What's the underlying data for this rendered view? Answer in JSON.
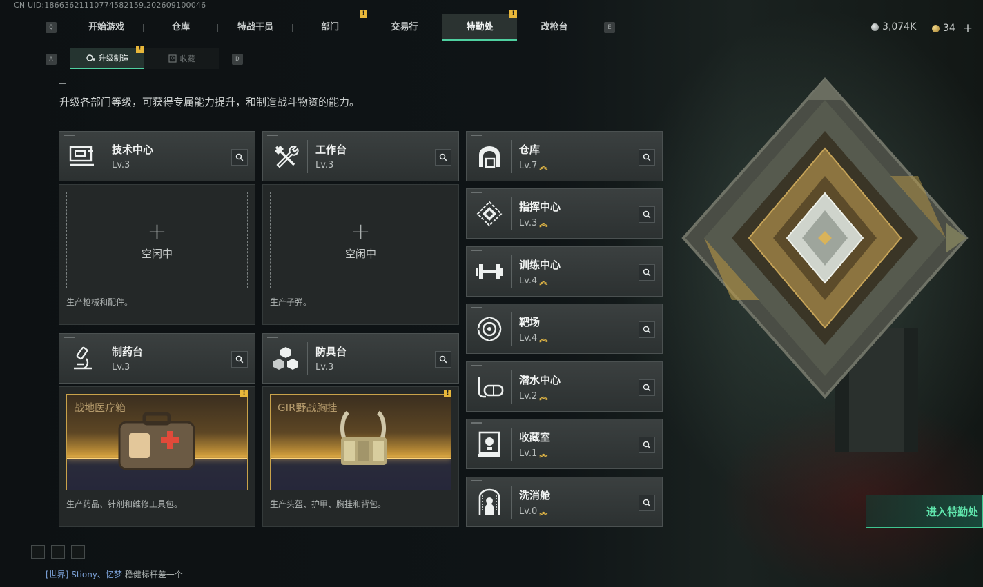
{
  "uid_line": "CN UID:18663621110774582159.202609100046",
  "nav": {
    "left_key": "Q",
    "right_key": "E",
    "tabs": [
      "开始游戏",
      "仓库",
      "特战干员",
      "部门",
      "交易行",
      "特勤处",
      "改枪台"
    ],
    "active_index": 5,
    "badge_mark": "!"
  },
  "currency": {
    "coins": "3,074K",
    "gold": "34",
    "plus": "+"
  },
  "subnav": {
    "left_key": "A",
    "right_key": "D",
    "upgrade_label": "升级制造",
    "collection_label": "收藏"
  },
  "description": "升级各部门等级，可获得专属能力提升，和制造战斗物资的能力。",
  "production_cards": [
    {
      "name": "技术中心",
      "level": "Lv.3",
      "icon": "computer-icon",
      "state": "空闲中",
      "caption": "生产枪械和配件。"
    },
    {
      "name": "工作台",
      "level": "Lv.3",
      "icon": "tools-icon",
      "state": "空闲中",
      "caption": "生产子弹。"
    },
    {
      "name": "制药台",
      "level": "Lv.3",
      "icon": "microscope-icon",
      "item": "战地医疗箱",
      "caption": "生产药品、针剂和维修工具包。"
    },
    {
      "name": "防具台",
      "level": "Lv.3",
      "icon": "armor-blocks-icon",
      "item": "GIR野战胸挂",
      "caption": "生产头盔、护甲、胸挂和背包。"
    }
  ],
  "plus_sign": "+",
  "facilities": [
    {
      "name": "仓库",
      "level": "Lv.7",
      "icon": "warehouse-icon"
    },
    {
      "name": "指挥中心",
      "level": "Lv.3",
      "icon": "command-icon"
    },
    {
      "name": "训练中心",
      "level": "Lv.4",
      "icon": "dumbbell-icon"
    },
    {
      "name": "靶场",
      "level": "Lv.4",
      "icon": "target-icon"
    },
    {
      "name": "潜水中心",
      "level": "Lv.2",
      "icon": "diving-mask-icon"
    },
    {
      "name": "收藏室",
      "level": "Lv.1",
      "icon": "trophy-case-icon"
    },
    {
      "name": "洗消舱",
      "level": "Lv.0",
      "icon": "decontamination-icon"
    }
  ],
  "upgrade_arrow": "︽",
  "enter_button": "进入特勤处",
  "chat": {
    "channel": "[世界]",
    "user": "Stiony、忆梦",
    "message": "稳健标杆差一个"
  },
  "colors": {
    "accent": "#4fd0a0",
    "badge": "#e8b73a",
    "gold_frame": "#c9a24a"
  }
}
